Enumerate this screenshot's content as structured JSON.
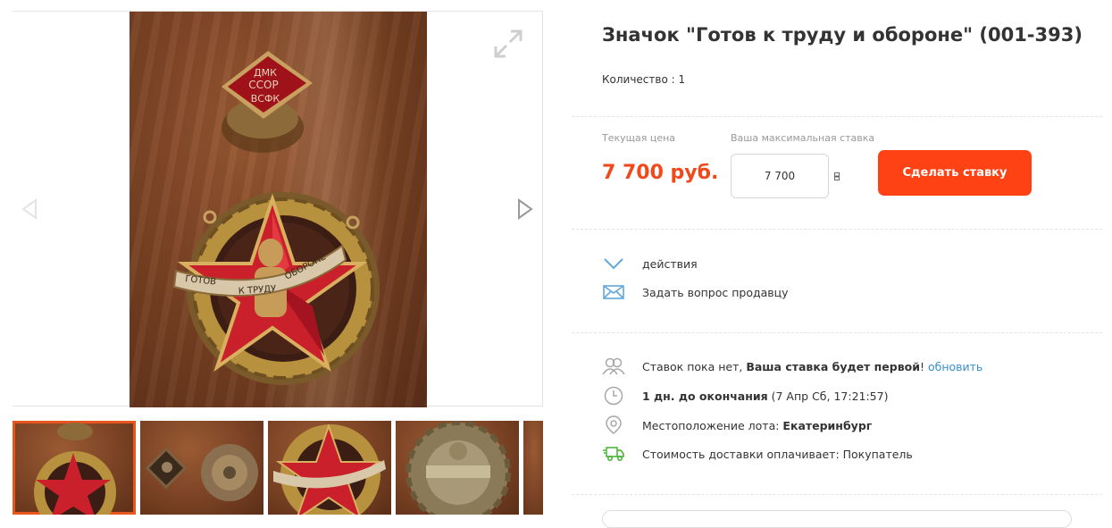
{
  "lot": {
    "title": "Значок \"Готов к труду и обороне\" (001-393)",
    "quantity_label": "Количество : 1"
  },
  "pricing": {
    "current_label": "Текущая цена",
    "current_price": "7 700 руб.",
    "max_bid_label": "Ваша максимальная ставка",
    "max_bid_value": "7 700",
    "bid_button": "Сделать ставку"
  },
  "actions": {
    "actions_label": "действия",
    "ask_seller": "Задать вопрос продавцу"
  },
  "status": {
    "bids_text": "Ставок пока нет, ",
    "bids_bold": "Ваша ставка будет первой",
    "bids_excl": "! ",
    "refresh_link": "обновить",
    "time_bold": "1 дн. до окончания",
    "time_rest": " (7 Апр Сб, 17:21:57)",
    "location_label": "Местоположение лота: ",
    "location_value": "Екатеринбург",
    "shipping": "Стоимость доставки оплачивает: Покупатель"
  },
  "badge": {
    "top_line1": "ДМК",
    "top_line2": "ССОР",
    "top_line3": "ВСФК",
    "ribbon_left": "ГОТОВ",
    "ribbon_mid": "К ТРУДУ",
    "ribbon_right": "ОБОРОНЕ"
  },
  "colors": {
    "accent": "#ff4214",
    "price": "#ee4a1b",
    "link": "#3a8fd0",
    "green": "#42b02a"
  },
  "icons": [
    "expand-icon",
    "arrow-left-icon",
    "arrow-right-icon",
    "chevron-down-icon",
    "envelope-icon",
    "users-icon",
    "clock-icon",
    "location-pin-icon",
    "truck-icon"
  ]
}
